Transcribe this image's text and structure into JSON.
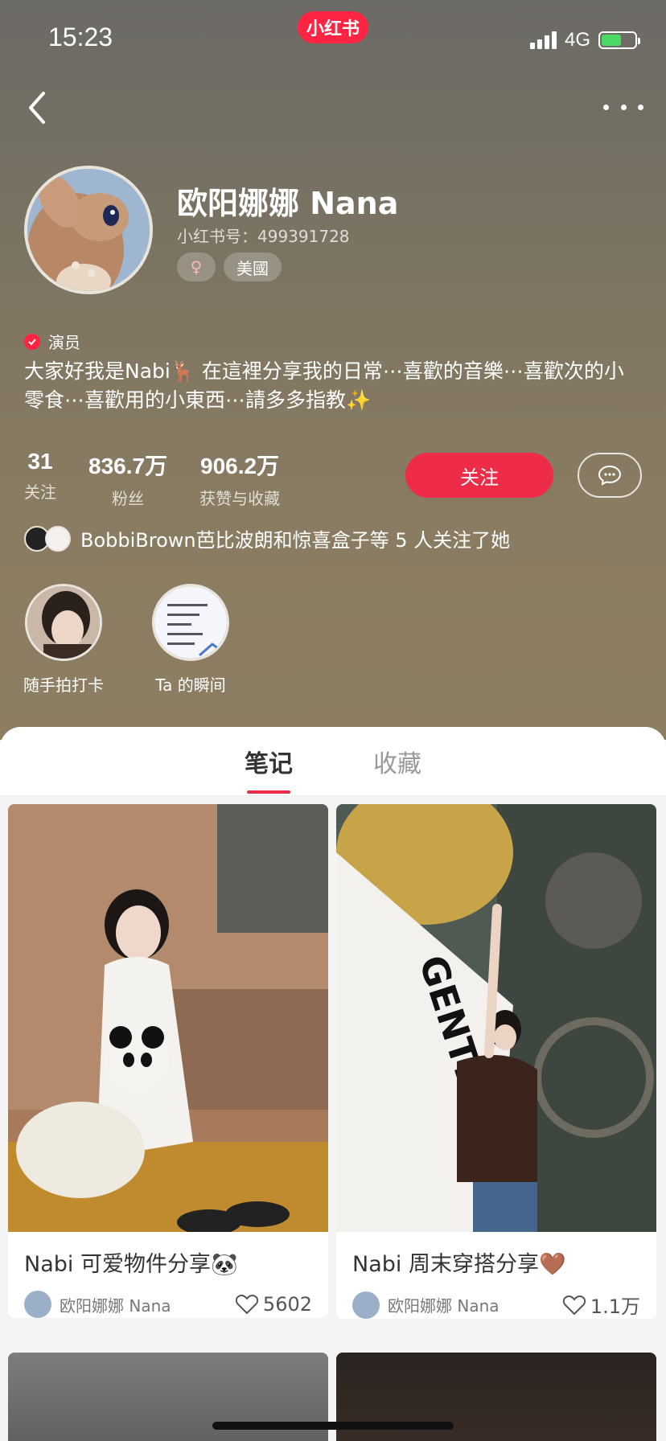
{
  "status": {
    "time": "15:23",
    "app_pill": "小红书",
    "network": "4G"
  },
  "profile": {
    "name": "欧阳娜娜 Nana",
    "redid_label": "小红书号：",
    "redid": "499391728",
    "gender_symbol": "♀",
    "location": "美國",
    "verified_label": "演员",
    "bio": "大家好我是Nabi🦌 在這裡分享我的日常⋯喜歡的音樂⋯喜歡次的小零食⋯喜歡用的小東西⋯請多多指教✨"
  },
  "stats": [
    {
      "value": "31",
      "label": "关注"
    },
    {
      "value": "836.7万",
      "label": "粉丝"
    },
    {
      "value": "906.2万",
      "label": "获赞与收藏"
    }
  ],
  "actions": {
    "follow": "关注"
  },
  "mutual_text": "BobbiBrown芭比波朗和惊喜盒子等 5 人关注了她",
  "highlights": [
    {
      "label": "随手拍打卡"
    },
    {
      "label": "Ta 的瞬间"
    }
  ],
  "tabs": [
    {
      "label": "笔记"
    },
    {
      "label": "收藏"
    }
  ],
  "notes": [
    {
      "title": "Nabi 可爱物件分享🐼",
      "author": "欧阳娜娜 Nana",
      "likes": "5602"
    },
    {
      "title": "Nabi 周末穿搭分享🤎",
      "author": "欧阳娜娜 Nana",
      "likes": "1.1万"
    }
  ],
  "colors": {
    "accent": "#ef2c48",
    "header_bg": "#8a7c62"
  }
}
